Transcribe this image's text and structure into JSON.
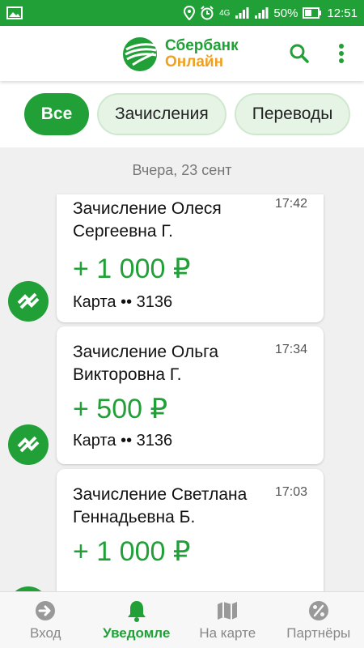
{
  "status_bar": {
    "network": "4G",
    "battery": "50%",
    "time": "12:51"
  },
  "header": {
    "logo_line1": "Сбербанк",
    "logo_line2": "Онлайн"
  },
  "filters": [
    {
      "label": "Все",
      "active": true
    },
    {
      "label": "Зачисления",
      "active": false
    },
    {
      "label": "Переводы",
      "active": false
    }
  ],
  "feed": {
    "date": "Вчера, 23 сент",
    "items": [
      {
        "title": "Зачисление Олеся Сергеевна Г.",
        "time": "17:42",
        "amount": "+ 1 000 ₽",
        "account": "Карта •• 3136"
      },
      {
        "title": "Зачисление Ольга Викторовна Г.",
        "time": "17:34",
        "amount": "+ 500 ₽",
        "account": "Карта •• 3136"
      },
      {
        "title": "Зачисление Светлана Геннадьевна Б.",
        "time": "17:03",
        "amount": "+ 1 000 ₽",
        "account": ""
      }
    ]
  },
  "bottom_nav": [
    {
      "label": "Вход",
      "icon": "login-icon",
      "active": false
    },
    {
      "label": "Уведомле",
      "icon": "bell-icon",
      "active": true
    },
    {
      "label": "На карте",
      "icon": "map-icon",
      "active": false
    },
    {
      "label": "Партнёры",
      "icon": "percent-icon",
      "active": false
    }
  ],
  "colors": {
    "brand_green": "#21a038",
    "logo_orange": "#f0a020"
  }
}
